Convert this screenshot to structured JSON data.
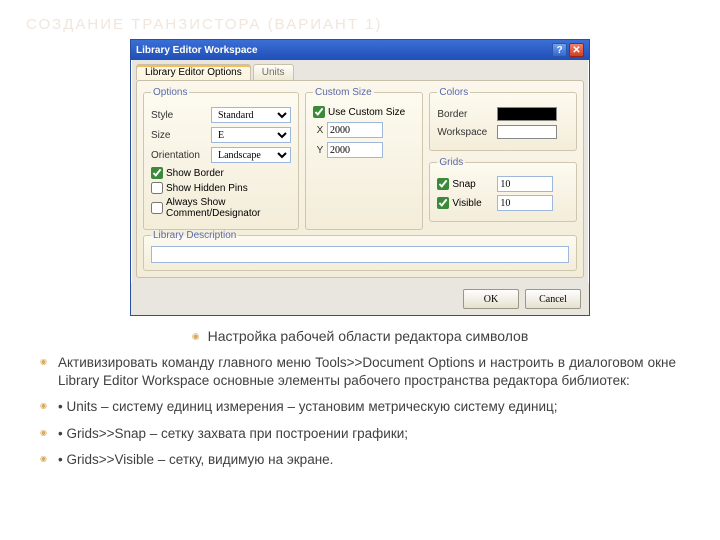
{
  "page_title": "СОЗДАНИЕ ТРАНЗИСТОРА (ВАРИАНТ 1)",
  "dialog": {
    "title": "Library Editor Workspace",
    "tabs": [
      "Library Editor Options",
      "Units"
    ],
    "active_tab": 0,
    "options": {
      "legend": "Options",
      "style_label": "Style",
      "style_value": "Standard",
      "size_label": "Size",
      "size_value": "E",
      "orientation_label": "Orientation",
      "orientation_value": "Landscape",
      "show_border": "Show Border",
      "show_hidden_pins": "Show Hidden Pins",
      "always_show": "Always Show Comment/Designator"
    },
    "custom": {
      "legend": "Custom Size",
      "use_custom": "Use Custom Size",
      "x_label": "X",
      "x_value": "2000",
      "y_label": "Y",
      "y_value": "2000"
    },
    "colors": {
      "legend": "Colors",
      "border_label": "Border",
      "border_value": "#000000",
      "workspace_label": "Workspace",
      "workspace_value": "#ffffff"
    },
    "grids": {
      "legend": "Grids",
      "snap_label": "Snap",
      "snap_value": "10",
      "visible_label": "Visible",
      "visible_value": "10"
    },
    "lib_desc_legend": "Library Description",
    "lib_desc_value": "",
    "ok": "OK",
    "cancel": "Cancel"
  },
  "caption": "Настройка рабочей области редактора символов",
  "bullets": [
    "Активизировать команду главного меню Tools>>Document Options и настроить в диалоговом окне Library Editor Workspace основные элементы рабочего пространства редактора библиотек:",
    "• Units – систему единиц измерения – установим метрическую систему единиц;",
    "• Grids>>Snap – сетку захвата при построении графики;",
    "• Grids>>Visible – сетку, видимую на экране."
  ]
}
